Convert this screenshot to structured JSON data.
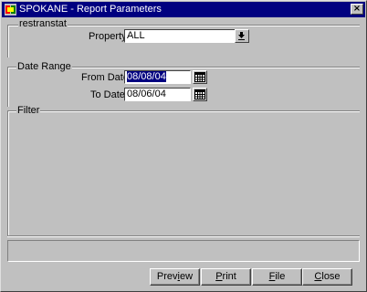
{
  "window": {
    "title": "SPOKANE - Report Parameters",
    "close_glyph": "×"
  },
  "report_group": {
    "label": "restranstat",
    "property_label": "Property",
    "property_value": "ALL",
    "dropdown_icon": "download-arrow-icon"
  },
  "date_range": {
    "label": "Date Range",
    "from_label": "From Date",
    "from_value": "08/08/04",
    "to_label": "To Date",
    "to_value": "08/06/04",
    "calendar_icon": "calendar-icon"
  },
  "filter": {
    "label": "Filter"
  },
  "buttons": {
    "preview": {
      "first": "Prev",
      "underline": "i",
      "rest": "ew"
    },
    "print": {
      "first": "",
      "underline": "P",
      "rest": "rint"
    },
    "file": {
      "first": "",
      "underline": "F",
      "rest": "ile"
    },
    "close": {
      "first": "",
      "underline": "C",
      "rest": "lose"
    }
  },
  "colors": {
    "titlebar": "#000080",
    "face": "#c0c0c0",
    "selection": "#000080"
  }
}
